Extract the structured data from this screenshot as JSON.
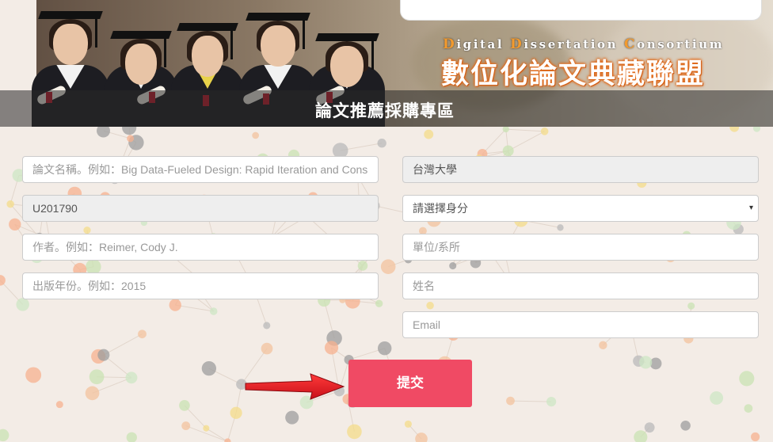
{
  "header": {
    "site_name_en": [
      {
        "initial": "D",
        "rest": "igital "
      },
      {
        "initial": "D",
        "rest": "issertation "
      },
      {
        "initial": "C",
        "rest": "onsortium"
      }
    ],
    "site_name_zh": "數位化論文典藏聯盟",
    "page_heading": "論文推薦採購專區"
  },
  "form": {
    "left": {
      "title_placeholder": "論文名稱。例如：Big Data-Fueled Design: Rapid Iteration and Cons",
      "id_value": "U201790",
      "author_placeholder": "作者。例如：Reimer, Cody J.",
      "year_placeholder": "出版年份。例如：2015"
    },
    "right": {
      "school_value": "台灣大學",
      "identity_selected": "請選擇身分",
      "dept_placeholder": "單位/系所",
      "name_placeholder": "姓名",
      "email_placeholder": "Email"
    },
    "submit_label": "提交",
    "caret_icon": "▾"
  },
  "colors": {
    "submit_bg": "#f04a64",
    "arrow": "#e0141e",
    "accent_orange": "#f29a2e"
  }
}
